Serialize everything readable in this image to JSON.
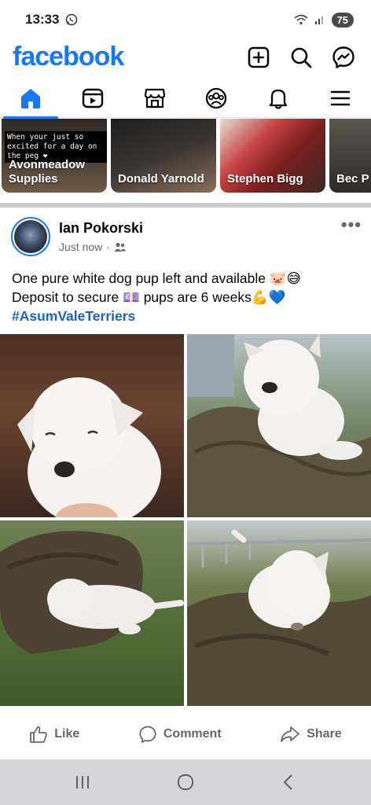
{
  "status_bar": {
    "time": "13:33",
    "battery": "75"
  },
  "header": {
    "logo": "facebook"
  },
  "stories": [
    {
      "name": "Avonmeadow\nSupplies",
      "caption": "When your just so excited for a day on the peg ❤"
    },
    {
      "name": "Donald Yarnold"
    },
    {
      "name": "Stephen Bigg"
    },
    {
      "name": "Bec P"
    }
  ],
  "post": {
    "author": "Ian Pokorski",
    "timestamp": "Just now",
    "separator": "·",
    "text_line1": "One pure white dog pup left and available 🐷😅",
    "text_line2": "Deposit to secure 💷 pups are 6 weeks💪💙",
    "hashtag": "#AsumValeTerriers",
    "more": "•••"
  },
  "actions": {
    "like": "Like",
    "comment": "Comment",
    "share": "Share"
  },
  "colors": {
    "brand": "#1877f2",
    "muted": "#65676b",
    "hashtag": "#1a61c9"
  }
}
